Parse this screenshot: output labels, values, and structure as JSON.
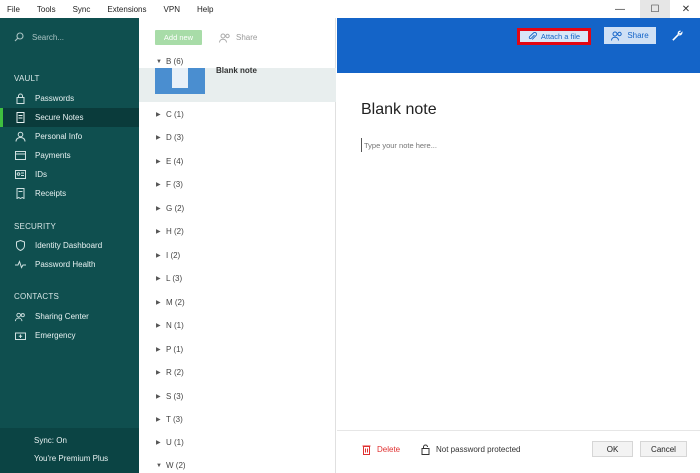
{
  "menu": [
    "File",
    "Tools",
    "Sync",
    "Extensions",
    "VPN",
    "Help"
  ],
  "window_controls": {
    "minimize": "—",
    "maximize": "☐",
    "close": "✕"
  },
  "sidebar": {
    "search_placeholder": "Search...",
    "vault_label": "VAULT",
    "vault_items": [
      "Passwords",
      "Secure Notes",
      "Personal Info",
      "Payments",
      "IDs",
      "Receipts"
    ],
    "security_label": "SECURITY",
    "security_items": [
      "Identity Dashboard",
      "Password Health"
    ],
    "contacts_label": "CONTACTS",
    "contacts_items": [
      "Sharing Center",
      "Emergency"
    ],
    "sync_status": "Sync: On",
    "premium": "You're Premium Plus"
  },
  "list": {
    "add_new": "Add new",
    "share": "Share",
    "groups": [
      "B (6)",
      "C (1)",
      "D (3)",
      "E (4)",
      "F (3)",
      "G (2)",
      "H (2)",
      "I (2)",
      "L (3)",
      "M (2)",
      "N (1)",
      "P (1)",
      "R (2)",
      "S (3)",
      "T (3)",
      "U (1)",
      "W (2)"
    ],
    "selected_note": "Blank note"
  },
  "detail": {
    "attach_label": "Attach a file",
    "share_label": "Share",
    "title": "Blank note",
    "note_placeholder": "Type your note here...",
    "delete_label": "Delete",
    "password_status": "Not password protected",
    "ok_label": "OK",
    "cancel_label": "Cancel"
  },
  "colors": {
    "sidebar": "#0f4f4f",
    "header": "#1464c8",
    "accent_green": "#3fbf3f",
    "highlight": "#e30613"
  }
}
